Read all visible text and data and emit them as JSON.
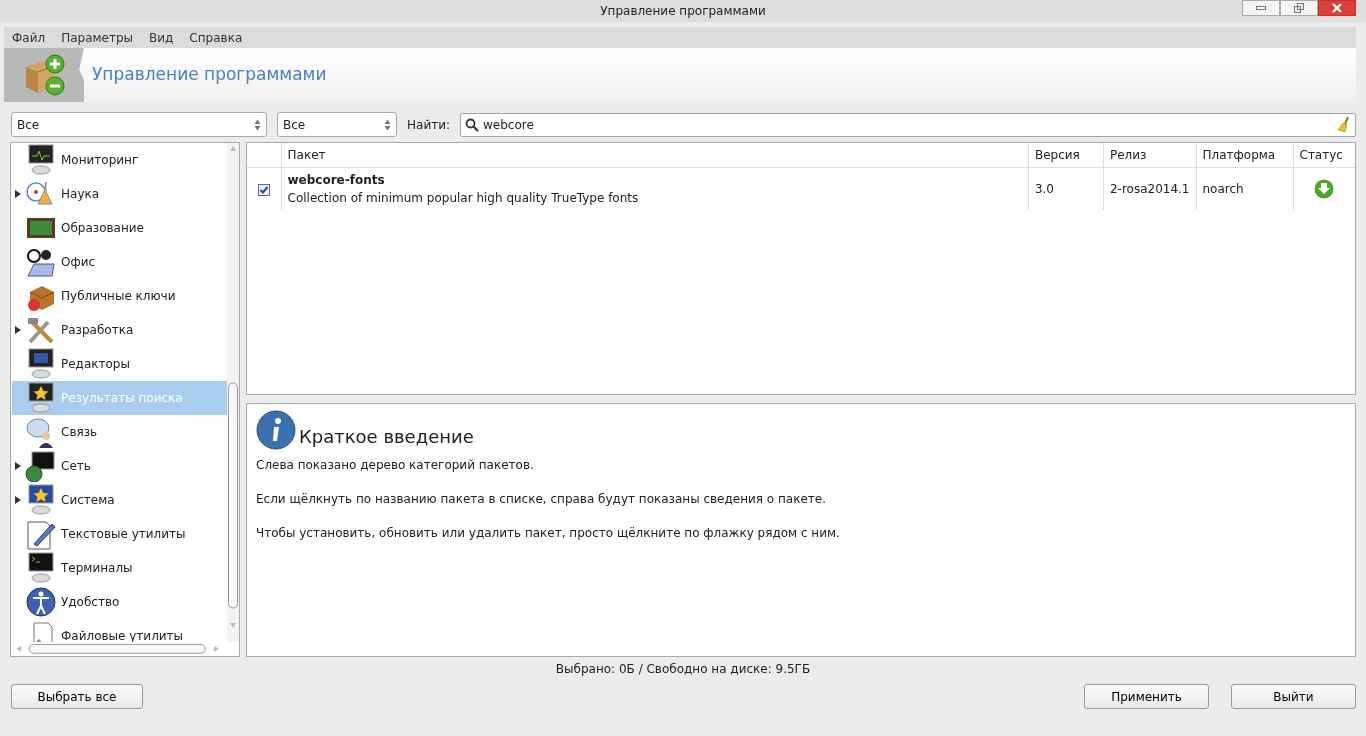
{
  "window": {
    "title": "Управление программами"
  },
  "menu": [
    "Файл",
    "Параметры",
    "Вид",
    "Справка"
  ],
  "header": {
    "title": "Управление программами"
  },
  "filters": [
    {
      "value": "Все"
    },
    {
      "value": "Все"
    }
  ],
  "search": {
    "label": "Найти:",
    "value": "webcore"
  },
  "categories": [
    {
      "label": "Мониторинг",
      "expandable": false,
      "selected": false
    },
    {
      "label": "Наука",
      "expandable": true,
      "selected": false
    },
    {
      "label": "Образование",
      "expandable": false,
      "selected": false
    },
    {
      "label": "Офис",
      "expandable": false,
      "selected": false
    },
    {
      "label": "Публичные ключи",
      "expandable": false,
      "selected": false
    },
    {
      "label": "Разработка",
      "expandable": true,
      "selected": false
    },
    {
      "label": "Редакторы",
      "expandable": false,
      "selected": false
    },
    {
      "label": "Результаты поиска",
      "expandable": false,
      "selected": true
    },
    {
      "label": "Связь",
      "expandable": false,
      "selected": false
    },
    {
      "label": "Сеть",
      "expandable": true,
      "selected": false
    },
    {
      "label": "Система",
      "expandable": true,
      "selected": false
    },
    {
      "label": "Текстовые утилиты",
      "expandable": false,
      "selected": false
    },
    {
      "label": "Терминалы",
      "expandable": false,
      "selected": false
    },
    {
      "label": "Удобство",
      "expandable": false,
      "selected": false
    },
    {
      "label": "Файловые утилиты",
      "expandable": false,
      "selected": false
    }
  ],
  "table": {
    "columns": [
      "Пакет",
      "Версия",
      "Релиз",
      "Платформа",
      "Статус"
    ],
    "rows": [
      {
        "checked": true,
        "name": "webcore-fonts",
        "summary": "Collection of minimum popular high quality TrueType fonts",
        "version": "3.0",
        "release": "2-rosa2014.1",
        "platform": "noarch",
        "kind": "install"
      }
    ]
  },
  "info": {
    "title": "Краткое введение",
    "paragraphs": [
      "Слева показано дерево категорий пакетов.",
      "Если щёлкнуть по названию пакета в списке, справа будут показаны сведения о пакете.",
      "Чтобы установить, обновить или удалить пакет, просто щёлкните по флажку рядом с ним."
    ]
  },
  "status_bar": "Выбрано: 0Б / Свободно на диске: 9.5ГБ",
  "buttons": {
    "left": "Выбрать все",
    "right": [
      "Применить",
      "Выйти"
    ]
  }
}
